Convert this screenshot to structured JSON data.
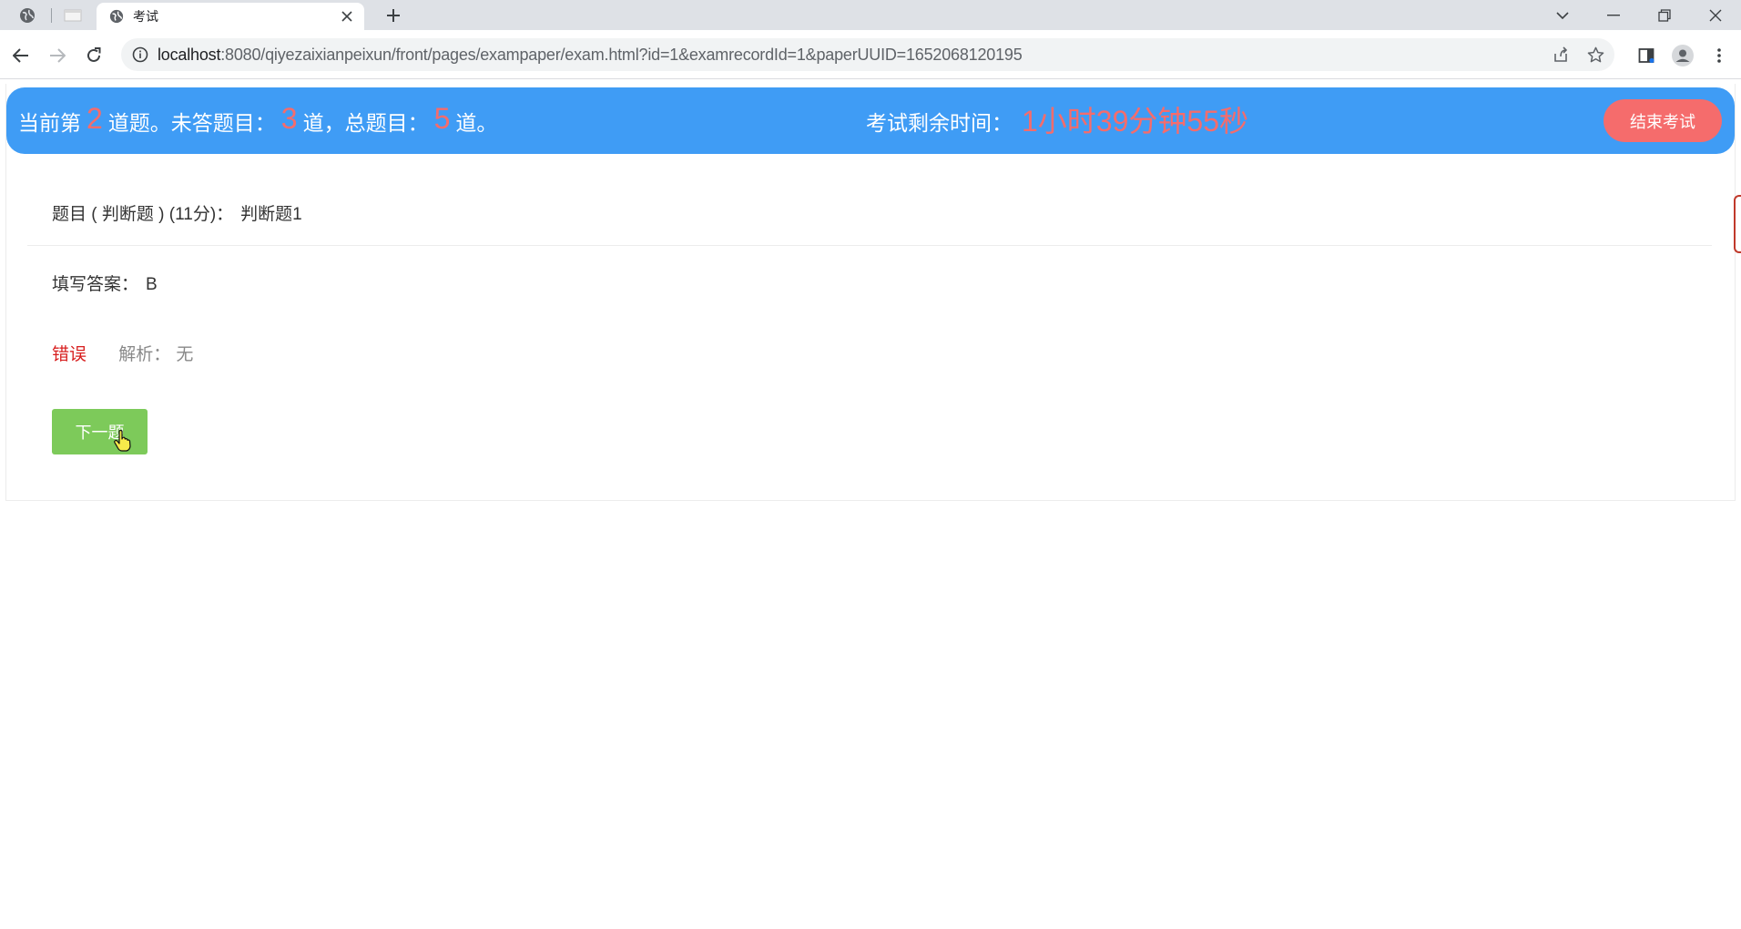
{
  "browser": {
    "active_tab": {
      "title": "考试"
    },
    "url": {
      "host": "localhost",
      "path": ":8080/qiyezaixianpeixun/front/pages/exampaper/exam.html?id=1&examrecordId=1&paperUUID=1652068120195"
    },
    "icons": {
      "pinned_tab_1": "globe-icon",
      "pinned_tab_2": "page-icon",
      "tab_favicon": "globe-icon",
      "tab_close": "close-icon",
      "new_tab": "plus-icon",
      "back": "arrow-left-icon",
      "forward": "arrow-right-icon",
      "reload": "reload-icon",
      "site_info": "info-icon",
      "share": "share-icon",
      "bookmark": "star-icon",
      "side_panel": "side-panel-icon",
      "profile": "profile-icon",
      "menu": "kebab-menu-icon",
      "tab_search": "chevron-down-icon",
      "minimize": "minimize-icon",
      "restore": "restore-icon",
      "close_window": "close-icon"
    }
  },
  "header": {
    "current_prefix": "当前第",
    "current_num": "2",
    "current_suffix": "道题。未答题目：",
    "unanswered_num": "3",
    "unanswered_suffix": "道，总题目：",
    "total_num": "5",
    "total_suffix": "道。",
    "time_label": "考试剩余时间：",
    "time_value": "1小时39分钟55秒",
    "end_button": "结束考试"
  },
  "question": {
    "label": "题目 ( 判断题 ) (11分)：",
    "text": "判断题1"
  },
  "answer": {
    "label": "填写答案：",
    "value": "B"
  },
  "result": {
    "status": "错误",
    "explanation_label": "解析：",
    "explanation_value": "无"
  },
  "next_button": "下一题",
  "colors": {
    "header_bg": "#3f9cf5",
    "accent_red": "#f56c6c",
    "wrong_red": "#d71e1e",
    "next_green": "#7dca5a"
  }
}
